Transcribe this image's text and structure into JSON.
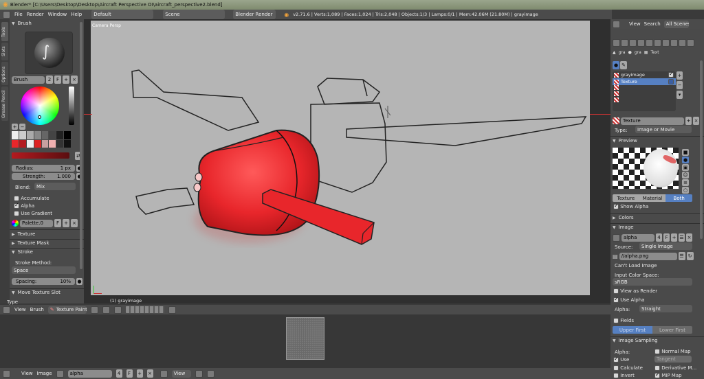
{
  "window": {
    "title": "Blender* [C:\\Users\\Desktop\\Desktop\\Aircraft Perspective OI\\aircraft_perspective2.blend]"
  },
  "topbar": {
    "menus": [
      "File",
      "Render",
      "Window",
      "Help"
    ],
    "layout": "Default",
    "scene": "Scene",
    "engine": "Blender Render",
    "stats": "v2.71.6 | Verts:1,089 | Faces:1,024 | Tris:2,048 | Objects:1/3 | Lamps:0/1 | Mem:42.06M (21.80M) | grayimage"
  },
  "left_tabs": [
    "Tools",
    "Slots",
    "Options",
    "Grease Pencil"
  ],
  "left_panel": {
    "brush_header": "Brush",
    "brush_name": "Brush",
    "brush_users": "2",
    "brush_fake": "F",
    "radius_label": "Radius:",
    "radius_value": "1 px",
    "strength_label": "Strength:",
    "strength_value": "1.000",
    "blend_label": "Blend:",
    "blend_value": "Mix",
    "accumulate": "Accumulate",
    "alpha": "Alpha",
    "use_gradient": "Use Gradient",
    "palette": "Palette.0",
    "palette_fake": "F",
    "texture_header": "Texture",
    "texture_mask_header": "Texture Mask",
    "stroke_header": "Stroke",
    "stroke_method_label": "Stroke Method:",
    "stroke_method": "Space",
    "spacing_label": "Spacing:",
    "spacing_value": "10%",
    "operator_header": "Move Texture Slot",
    "type_label": "Type"
  },
  "viewport": {
    "label": "Camera Persp",
    "object": "(1) grayimage",
    "header_menus": [
      "View",
      "Brush"
    ],
    "mode": "Texture Paint"
  },
  "image_editor": {
    "menus": [
      "View",
      "Image"
    ],
    "image_name": "alpha",
    "image_users": "4",
    "image_fake": "F",
    "view": "View"
  },
  "properties": {
    "header_menus": [
      "View",
      "Search"
    ],
    "all_scenes": "All Scenes",
    "breadcrumb": [
      "gra",
      "gra",
      "Text"
    ],
    "slots": [
      "grayimage",
      "Texture"
    ],
    "texture_name": "Texture",
    "type_label": "Type:",
    "type_value": "Image or Movie",
    "preview_header": "Preview",
    "preview_tabs": [
      "Texture",
      "Material",
      "Both"
    ],
    "show_alpha": "Show Alpha",
    "colors_header": "Colors",
    "image_header": "Image",
    "image_name": "alpha",
    "image_users": "4",
    "image_fake": "F",
    "source_label": "Source:",
    "source_value": "Single Image",
    "filepath": "//alpha.png",
    "cant_load": "Can't Load Image",
    "input_color_label": "Input Color Space:",
    "input_color_value": "sRGB",
    "view_as_render": "View as Render",
    "use_alpha": "Use Alpha",
    "alpha_label": "Alpha:",
    "alpha_value": "Straight",
    "fields": "Fields",
    "upper_first": "Upper First",
    "lower_first": "Lower First",
    "sampling_header": "Image Sampling",
    "samp_alpha": "Alpha:",
    "normal_map": "Normal Map",
    "use": "Use",
    "tangent": "Tangent",
    "calculate": "Calculate",
    "derivative_map": "Derivative M...",
    "invert": "Invert",
    "mip_map": "MIP Map"
  },
  "colors": {
    "accent_blue": "#5680c2",
    "paint_red": "#e8262b",
    "selection_orange": "#f2a33a"
  }
}
